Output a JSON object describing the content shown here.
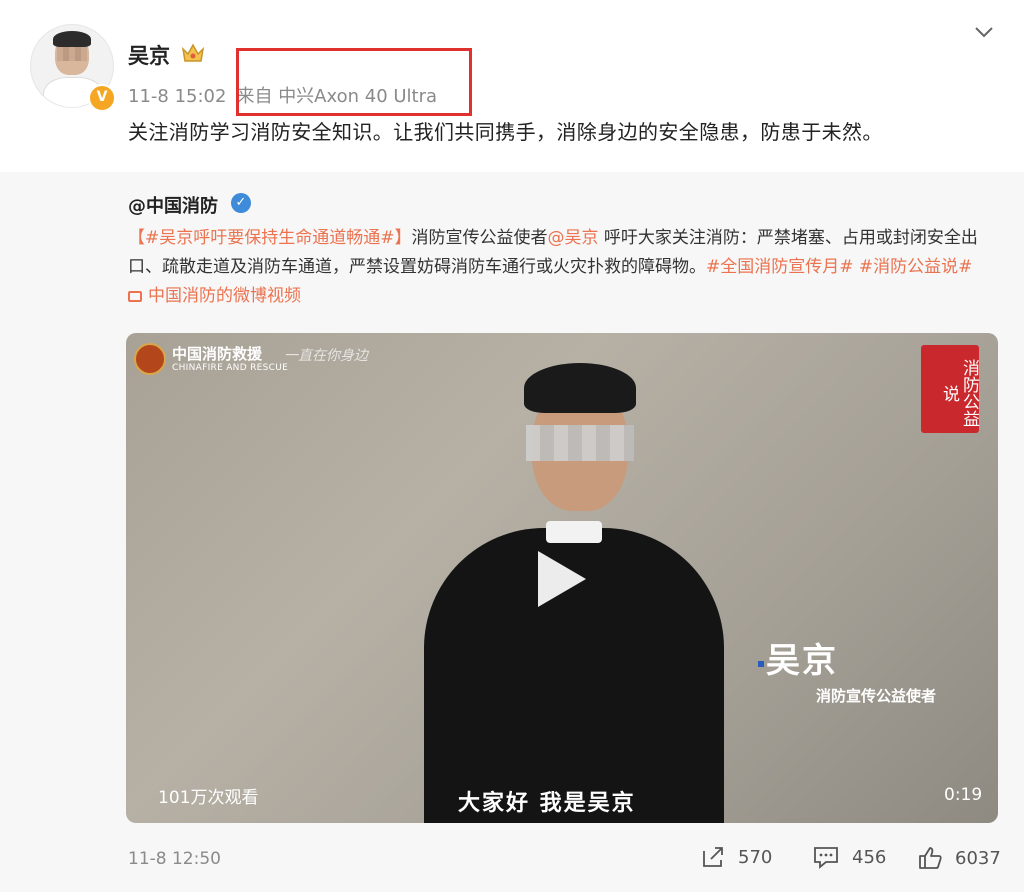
{
  "post": {
    "author": "吴京",
    "timestamp": "11-8 15:02",
    "source_prefix": "来自",
    "device": "中兴Axon 40 Ultra",
    "text": "关注消防学习消防安全知识。让我们共同携手，消除身边的安全隐患，防患于未然。"
  },
  "repost": {
    "author": "@中国消防",
    "tag1": "【#吴京呼吁要保持生命通道畅通#】",
    "t1": "消防宣传公益使者",
    "mention": "@吴京",
    "t2": "呼吁大家关注消防：严禁堵塞、占用或封闭安全出口、疏散走道及消防车通道，严禁设置妨碍消防车通行或火灾扑救的障碍物。",
    "tag2": "#全国消防宣传月#",
    "tag3": "#消防公益说#",
    "video_link": "中国消防的微博视频",
    "video": {
      "logo_cn": "中国消防救援",
      "logo_en": "CHINAFIRE AND RESCUE",
      "logo_script": "一直在你身边",
      "seal": "消防公益说",
      "name": "吴京",
      "role": "消防宣传公益使者",
      "views": "101万次观看",
      "subtitle": "大家好 我是吴京",
      "duration": "0:19"
    },
    "time": "11-8 12:50",
    "shares": "570",
    "comments": "456",
    "likes": "6037"
  },
  "colors": {
    "link": "#eb7350",
    "highlight_box": "#e1312e",
    "verified_orange": "#f5a623",
    "verified_blue": "#3d8bd9"
  },
  "icons": {
    "crown": "crown-icon",
    "chevron": "chevron-down-icon",
    "share": "share-icon",
    "comment": "comment-icon",
    "like": "thumbs-up-icon",
    "play": "play-icon"
  }
}
